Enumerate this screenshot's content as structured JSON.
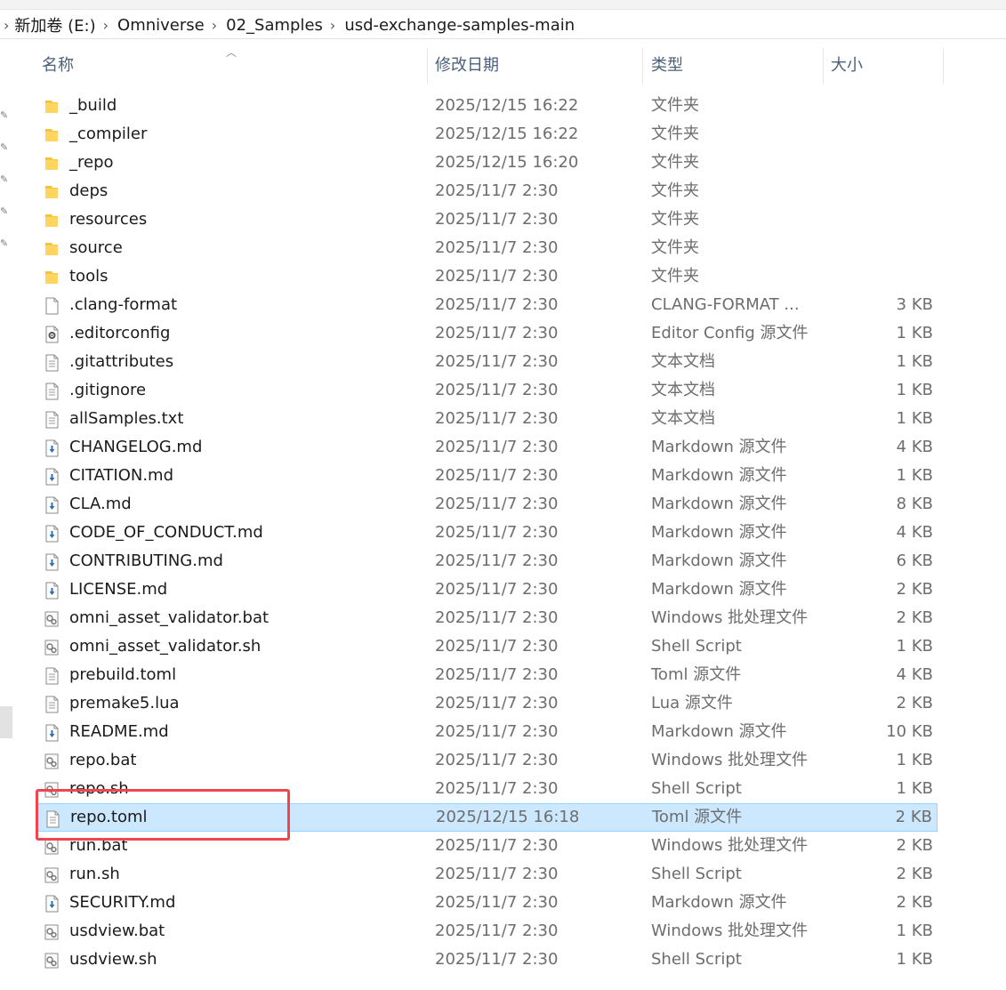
{
  "breadcrumb": [
    "新加卷 (E:)",
    "Omniverse",
    "02_Samples",
    "usd-exchange-samples-main"
  ],
  "columns": {
    "name": "名称",
    "date": "修改日期",
    "type": "类型",
    "size": "大小"
  },
  "colors": {
    "selection_bg": "#cce8ff",
    "selection_border": "#99d1ff",
    "highlight_box": "#f0454f",
    "folder": "#f8c23c"
  },
  "files": [
    {
      "name": "_build",
      "date": "2025/12/15 16:22",
      "type": "文件夹",
      "size": "",
      "icon": "folder-icon"
    },
    {
      "name": "_compiler",
      "date": "2025/12/15 16:22",
      "type": "文件夹",
      "size": "",
      "icon": "folder-icon"
    },
    {
      "name": "_repo",
      "date": "2025/12/15 16:20",
      "type": "文件夹",
      "size": "",
      "icon": "folder-icon"
    },
    {
      "name": "deps",
      "date": "2025/11/7 2:30",
      "type": "文件夹",
      "size": "",
      "icon": "folder-icon"
    },
    {
      "name": "resources",
      "date": "2025/11/7 2:30",
      "type": "文件夹",
      "size": "",
      "icon": "folder-icon"
    },
    {
      "name": "source",
      "date": "2025/11/7 2:30",
      "type": "文件夹",
      "size": "",
      "icon": "folder-icon"
    },
    {
      "name": "tools",
      "date": "2025/11/7 2:30",
      "type": "文件夹",
      "size": "",
      "icon": "folder-icon"
    },
    {
      "name": ".clang-format",
      "date": "2025/11/7 2:30",
      "type": "CLANG-FORMAT ...",
      "size": "3 KB",
      "icon": "blank-file-icon"
    },
    {
      "name": ".editorconfig",
      "date": "2025/11/7 2:30",
      "type": "Editor Config 源文件",
      "size": "1 KB",
      "icon": "config-file-icon"
    },
    {
      "name": ".gitattributes",
      "date": "2025/11/7 2:30",
      "type": "文本文档",
      "size": "1 KB",
      "icon": "text-file-icon"
    },
    {
      "name": ".gitignore",
      "date": "2025/11/7 2:30",
      "type": "文本文档",
      "size": "1 KB",
      "icon": "text-file-icon"
    },
    {
      "name": "allSamples.txt",
      "date": "2025/11/7 2:30",
      "type": "文本文档",
      "size": "1 KB",
      "icon": "text-file-icon"
    },
    {
      "name": "CHANGELOG.md",
      "date": "2025/11/7 2:30",
      "type": "Markdown 源文件",
      "size": "4 KB",
      "icon": "markdown-file-icon"
    },
    {
      "name": "CITATION.md",
      "date": "2025/11/7 2:30",
      "type": "Markdown 源文件",
      "size": "1 KB",
      "icon": "markdown-file-icon"
    },
    {
      "name": "CLA.md",
      "date": "2025/11/7 2:30",
      "type": "Markdown 源文件",
      "size": "8 KB",
      "icon": "markdown-file-icon"
    },
    {
      "name": "CODE_OF_CONDUCT.md",
      "date": "2025/11/7 2:30",
      "type": "Markdown 源文件",
      "size": "4 KB",
      "icon": "markdown-file-icon"
    },
    {
      "name": "CONTRIBUTING.md",
      "date": "2025/11/7 2:30",
      "type": "Markdown 源文件",
      "size": "6 KB",
      "icon": "markdown-file-icon"
    },
    {
      "name": "LICENSE.md",
      "date": "2025/11/7 2:30",
      "type": "Markdown 源文件",
      "size": "2 KB",
      "icon": "markdown-file-icon"
    },
    {
      "name": "omni_asset_validator.bat",
      "date": "2025/11/7 2:30",
      "type": "Windows 批处理文件",
      "size": "2 KB",
      "icon": "script-file-icon"
    },
    {
      "name": "omni_asset_validator.sh",
      "date": "2025/11/7 2:30",
      "type": "Shell Script",
      "size": "1 KB",
      "icon": "script-file-icon"
    },
    {
      "name": "prebuild.toml",
      "date": "2025/11/7 2:30",
      "type": "Toml 源文件",
      "size": "4 KB",
      "icon": "text-file-icon"
    },
    {
      "name": "premake5.lua",
      "date": "2025/11/7 2:30",
      "type": "Lua 源文件",
      "size": "2 KB",
      "icon": "text-file-icon"
    },
    {
      "name": "README.md",
      "date": "2025/11/7 2:30",
      "type": "Markdown 源文件",
      "size": "10 KB",
      "icon": "markdown-file-icon"
    },
    {
      "name": "repo.bat",
      "date": "2025/11/7 2:30",
      "type": "Windows 批处理文件",
      "size": "1 KB",
      "icon": "script-file-icon"
    },
    {
      "name": "repo.sh",
      "date": "2025/11/7 2:30",
      "type": "Shell Script",
      "size": "1 KB",
      "icon": "script-file-icon"
    },
    {
      "name": "repo.toml",
      "date": "2025/12/15 16:18",
      "type": "Toml 源文件",
      "size": "2 KB",
      "icon": "text-file-icon",
      "selected": true
    },
    {
      "name": "run.bat",
      "date": "2025/11/7 2:30",
      "type": "Windows 批处理文件",
      "size": "2 KB",
      "icon": "script-file-icon"
    },
    {
      "name": "run.sh",
      "date": "2025/11/7 2:30",
      "type": "Shell Script",
      "size": "2 KB",
      "icon": "script-file-icon"
    },
    {
      "name": "SECURITY.md",
      "date": "2025/11/7 2:30",
      "type": "Markdown 源文件",
      "size": "2 KB",
      "icon": "markdown-file-icon"
    },
    {
      "name": "usdview.bat",
      "date": "2025/11/7 2:30",
      "type": "Windows 批处理文件",
      "size": "1 KB",
      "icon": "script-file-icon"
    },
    {
      "name": "usdview.sh",
      "date": "2025/11/7 2:30",
      "type": "Shell Script",
      "size": "1 KB",
      "icon": "script-file-icon"
    }
  ]
}
